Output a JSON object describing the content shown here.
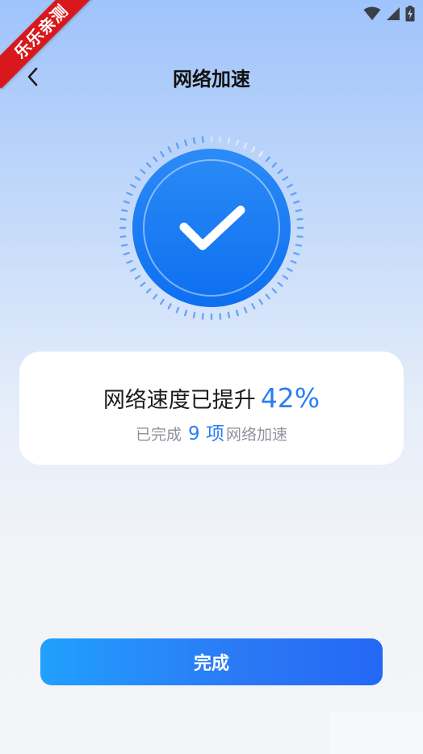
{
  "ribbon": {
    "text": "乐乐亲测"
  },
  "status_bar": {
    "icons": [
      "wifi-icon",
      "signal-icon",
      "battery-charging-icon"
    ]
  },
  "header": {
    "title": "网络加速",
    "back_icon": "chevron-left-icon"
  },
  "result": {
    "main_text": "网络速度已提升",
    "percent": "42%",
    "sub_prefix": "已完成",
    "count": "9 项",
    "sub_suffix": "网络加速"
  },
  "done_button": {
    "label": "完成"
  },
  "colors": {
    "accent": "#2a7ff3",
    "circle_top": "#2b8bf6",
    "circle_bottom": "#0d6ff1",
    "button_start": "#21a0fd",
    "button_end": "#2468f5",
    "ribbon": "#d8181c"
  }
}
